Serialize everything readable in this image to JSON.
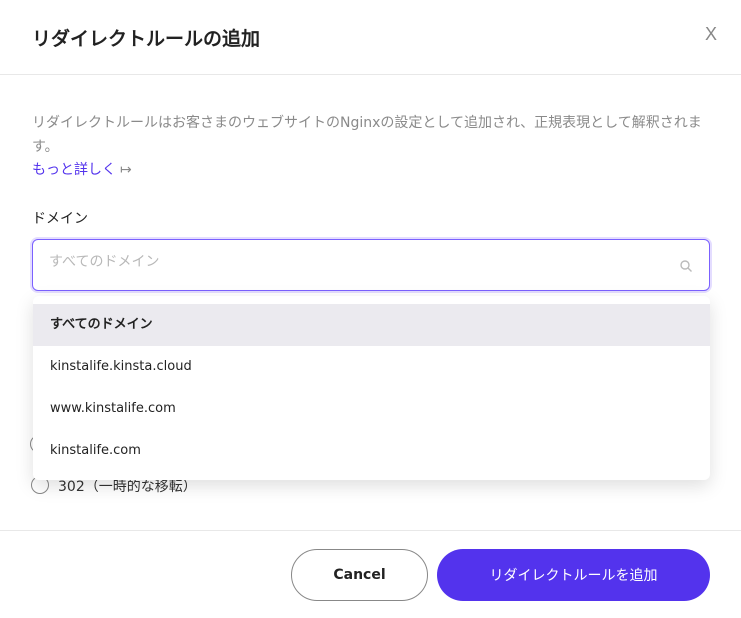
{
  "dialog": {
    "title": "リダイレクトルールの追加",
    "close_label": "X",
    "description": "リダイレクトルールはお客さまのウェブサイトのNginxの設定として追加され、正規表現として解釈されます。",
    "learn_more": "もっと詳しく",
    "learn_more_icon": "↦",
    "domain_label": "ドメイン",
    "domain_placeholder": "すべてのドメイン",
    "domain_options": [
      "すべてのドメイン",
      "kinstalife.kinsta.cloud",
      "www.kinstalife.com",
      "kinstalife.com"
    ],
    "radio_302_label": "302（一時的な移転）",
    "cancel_label": "Cancel",
    "submit_label": "リダイレクトルールを追加"
  },
  "colors": {
    "accent": "#5333ed",
    "focus_border": "#7b61ff"
  }
}
